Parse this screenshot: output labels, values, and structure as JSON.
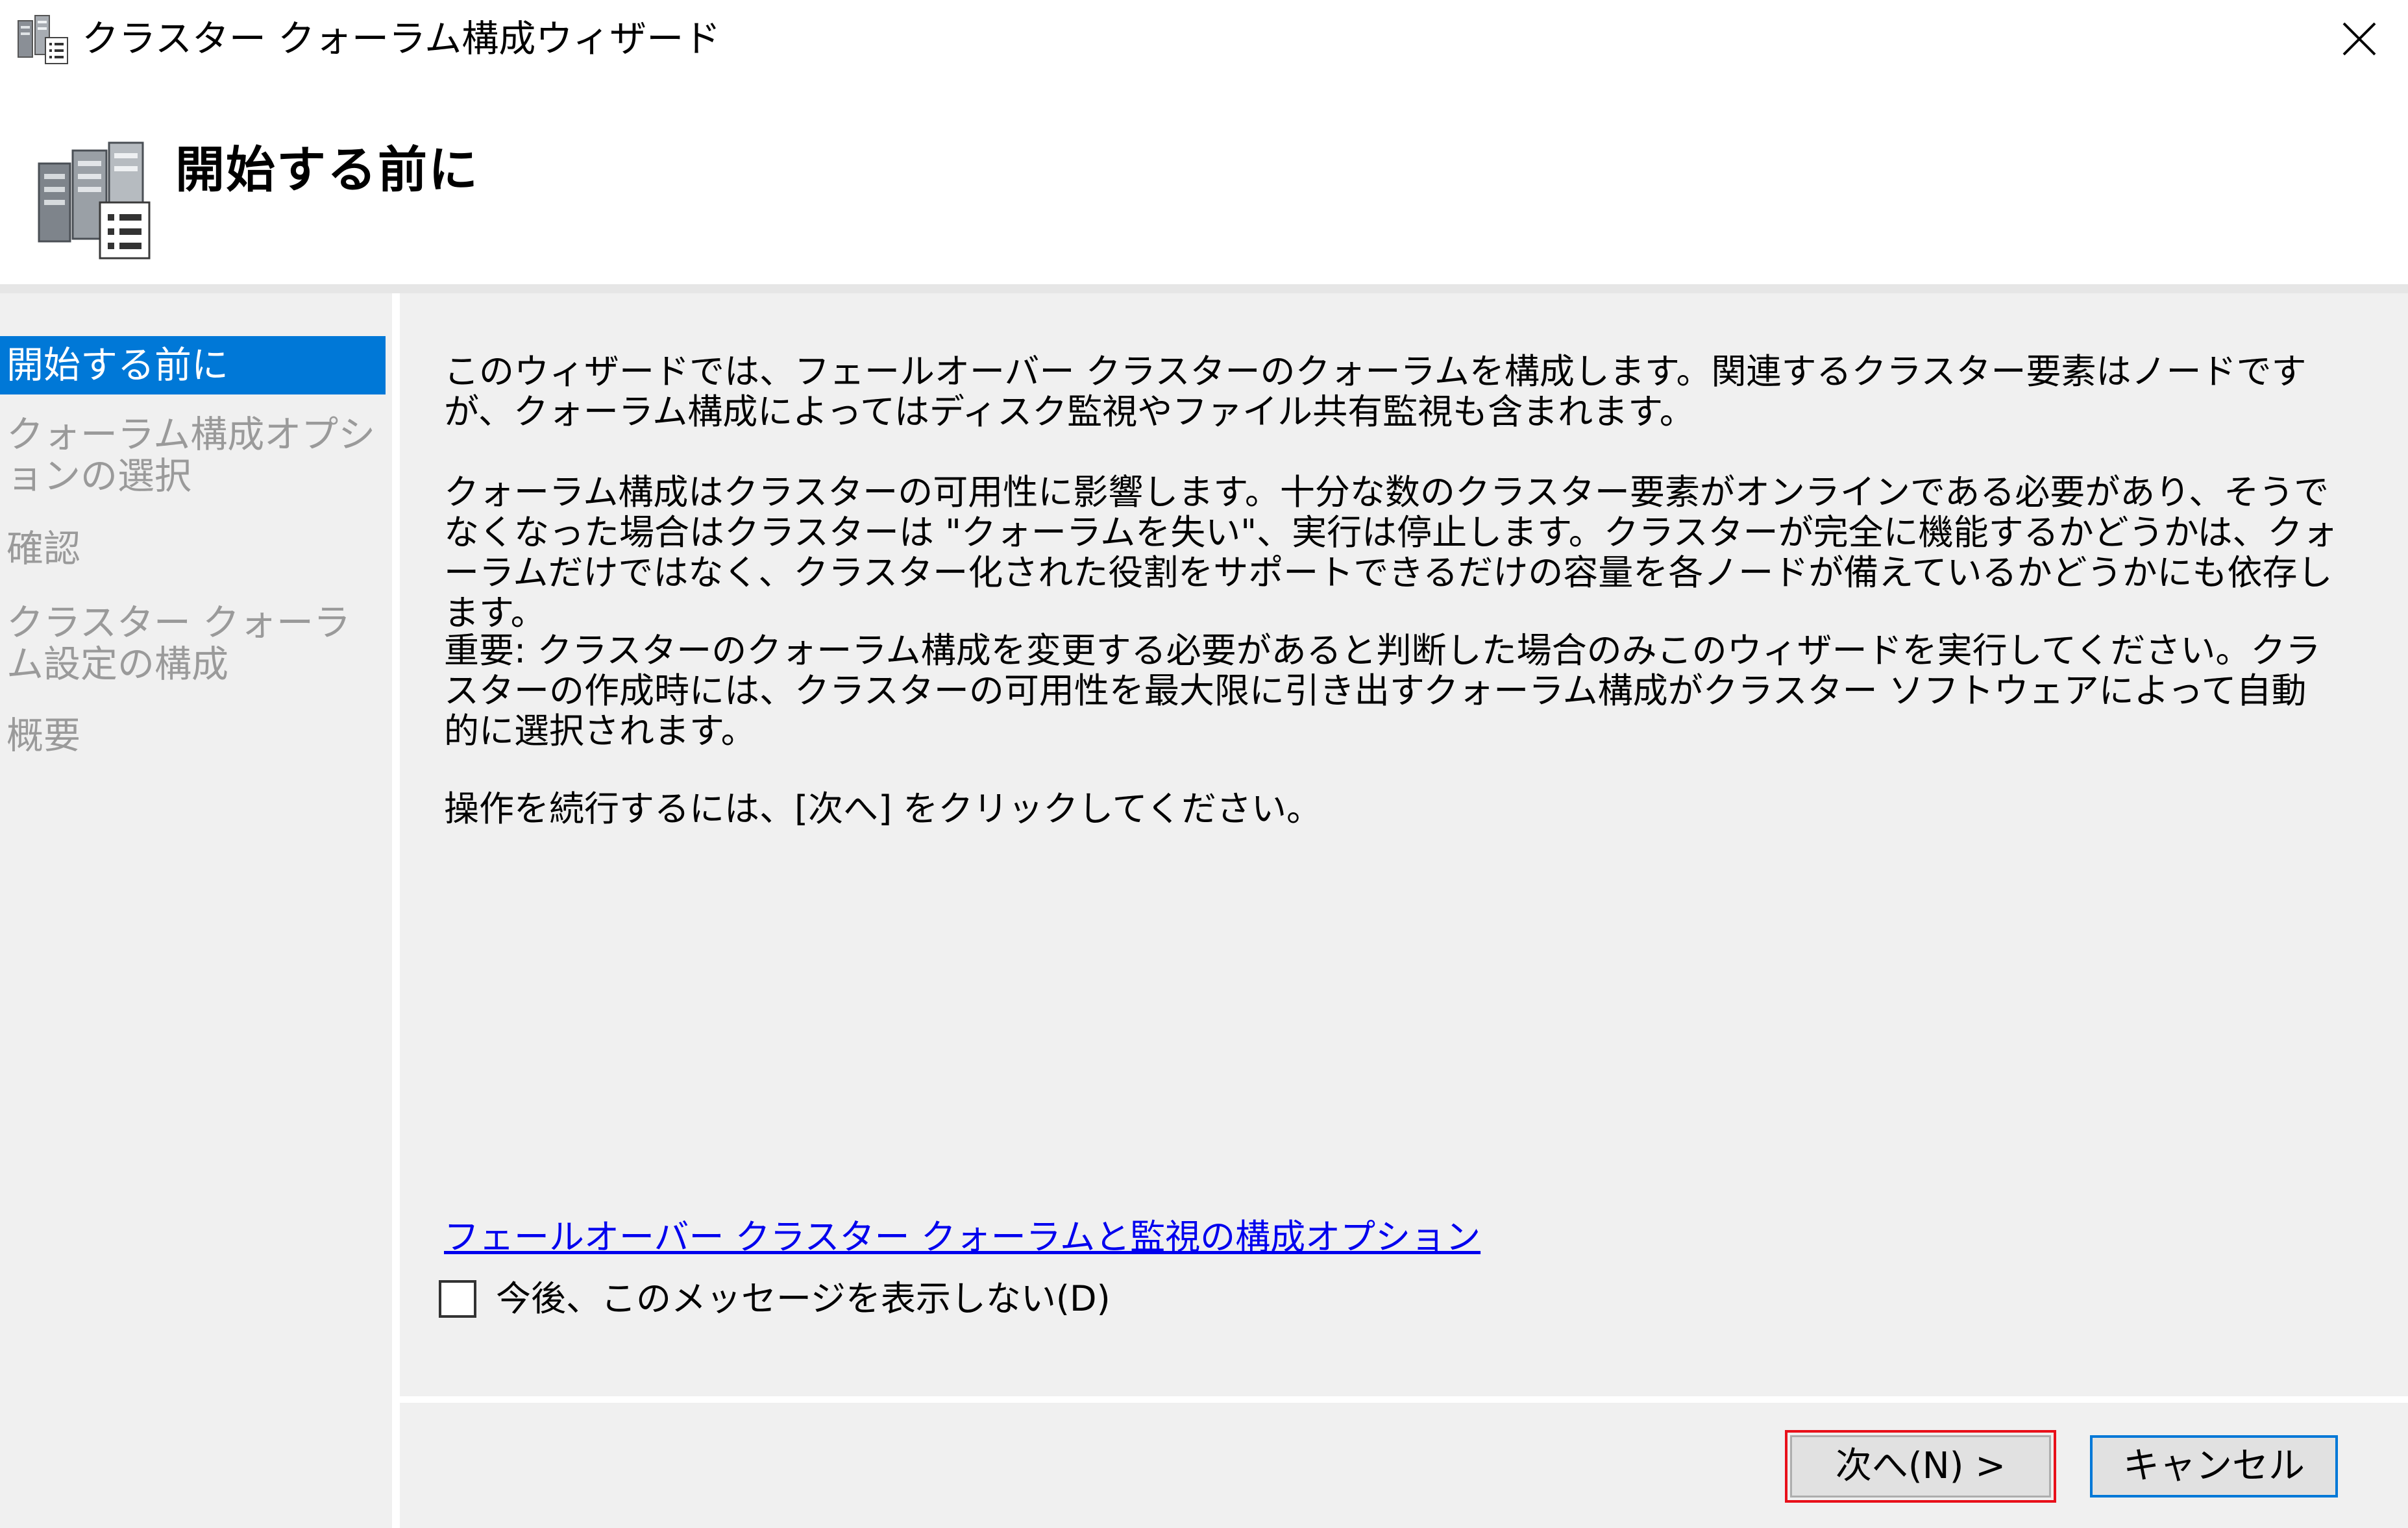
{
  "window": {
    "title": "クラスター クォーラム構成ウィザード"
  },
  "header": {
    "title": "開始する前に"
  },
  "nav": {
    "items": [
      {
        "label": "開始する前に",
        "active": true
      },
      {
        "label": "クォーラム構成オプションの選択",
        "active": false
      },
      {
        "label": "確認",
        "active": false
      },
      {
        "label": "クラスター クォーラム設定の構成",
        "active": false
      },
      {
        "label": "概要",
        "active": false
      }
    ]
  },
  "content": {
    "paragraphs": [
      "このウィザードでは、フェールオーバー クラスターのクォーラムを構成します。関連するクラスター要素はノードですが、クォーラム構成によってはディスク監視やファイル共有監視も含まれます。",
      "クォーラム構成はクラスターの可用性に影響します。十分な数のクラスター要素がオンラインである必要があり、そうでなくなった場合はクラスターは \"クォーラムを失い\"、実行は停止します。クラスターが完全に機能するかどうかは、クォーラムだけではなく、クラスター化された役割をサポートできるだけの容量を各ノードが備えているかどうかにも依存します。",
      "重要: クラスターのクォーラム構成を変更する必要があると判断した場合のみこのウィザードを実行してください。クラスターの作成時には、クラスターの可用性を最大限に引き出すクォーラム構成がクラスター ソフトウェアによって自動的に選択されます。",
      "操作を続行するには、[次へ] をクリックしてください。"
    ],
    "help_link": "フェールオーバー クラスター クォーラムと監視の構成オプション",
    "checkbox_label": "今後、このメッセージを表示しない(D)",
    "checkbox_checked": false
  },
  "footer": {
    "next_label": "次へ(N) >",
    "cancel_label": "キャンセル"
  },
  "colors": {
    "nav_active": "#0078d7",
    "link": "#0000ee",
    "highlight_box": "#e8101a"
  }
}
